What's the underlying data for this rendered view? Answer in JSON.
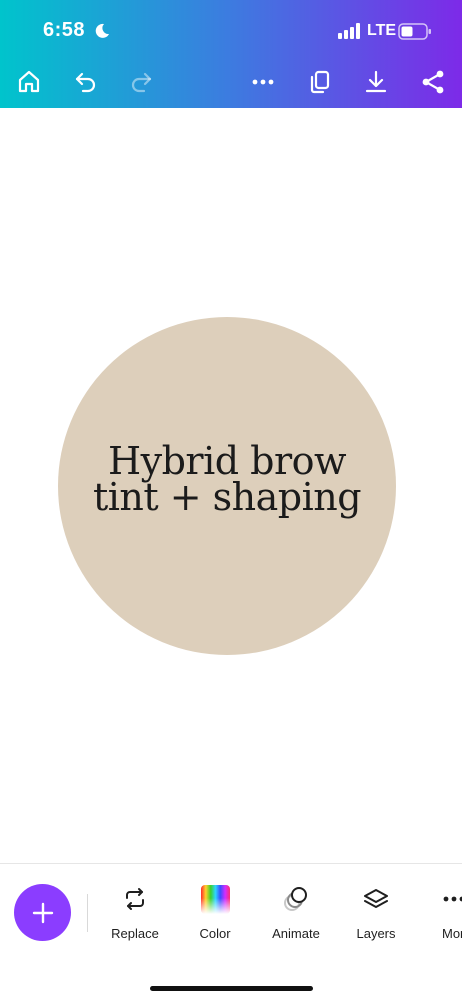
{
  "status_bar": {
    "time": "6:58",
    "network": "LTE",
    "icons": [
      "moon-icon",
      "signal-icon",
      "battery-icon"
    ]
  },
  "toolbar": {
    "icons": [
      "home-icon",
      "undo-icon",
      "redo-icon",
      "more-icon",
      "duplicate-icon",
      "download-icon",
      "share-icon"
    ]
  },
  "design": {
    "line1": "Hybrid brow",
    "line2": "tint + shaping",
    "circle_color": "#ddcfbb"
  },
  "bottom_toolbar": {
    "add_icon": "plus-icon",
    "tools": [
      {
        "label": "Replace",
        "icon": "replace-icon"
      },
      {
        "label": "Color",
        "icon": "color-icon"
      },
      {
        "label": "Animate",
        "icon": "animate-icon"
      },
      {
        "label": "Layers",
        "icon": "layers-icon"
      },
      {
        "label": "Mor",
        "icon": "more-icon"
      }
    ]
  },
  "colors": {
    "gradient_start": "#00c4cc",
    "gradient_end": "#7d2ae8",
    "accent": "#8b3dff"
  }
}
